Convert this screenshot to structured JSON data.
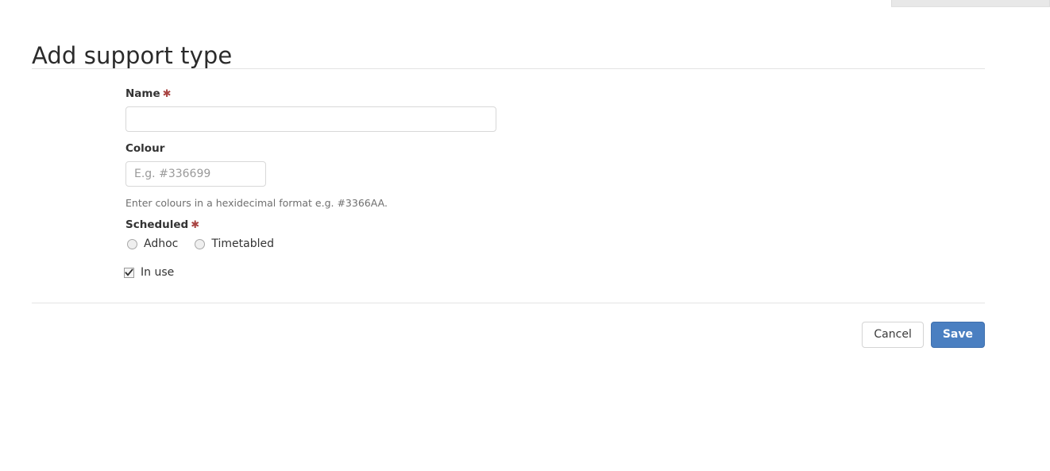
{
  "page": {
    "title": "Add support type"
  },
  "form": {
    "name": {
      "label": "Name",
      "required_marker": "✱",
      "value": "",
      "placeholder": ""
    },
    "colour": {
      "label": "Colour",
      "value": "",
      "placeholder": "E.g. #336699",
      "help_text": "Enter colours in a hexidecimal format e.g. #3366AA."
    },
    "scheduled": {
      "label": "Scheduled",
      "required_marker": "✱",
      "options": [
        {
          "label": "Adhoc",
          "selected": false
        },
        {
          "label": "Timetabled",
          "selected": false
        }
      ]
    },
    "in_use": {
      "label": "In use",
      "checked": true
    }
  },
  "actions": {
    "cancel_label": "Cancel",
    "save_label": "Save"
  },
  "colors": {
    "primary": "#4a7fc1",
    "required": "#a94442",
    "divider": "#e4e4e4",
    "help_text": "#6f6f6f"
  }
}
